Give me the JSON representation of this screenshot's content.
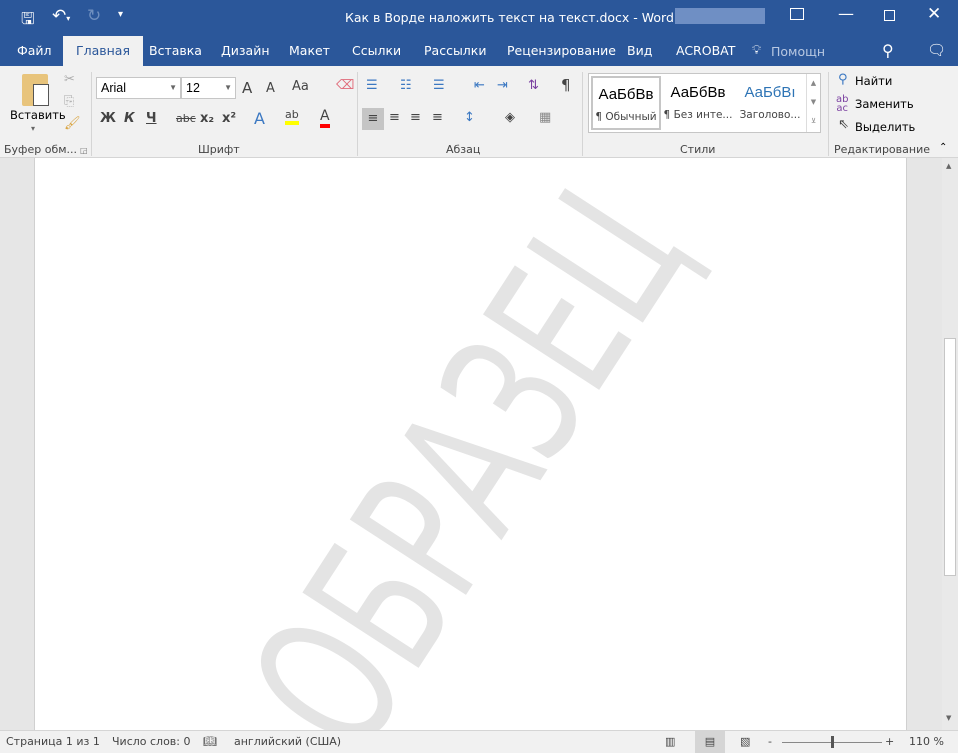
{
  "title_bar": {
    "title": "Как в Ворде наложить текст на текст.docx - Word",
    "icons": [
      "save-icon",
      "undo-icon",
      "redo-icon",
      "customize-qat-icon",
      "ribbon-display-icon",
      "minimize-icon",
      "maximize-icon",
      "close-icon"
    ]
  },
  "tabs": [
    {
      "label": "Файл"
    },
    {
      "label": "Главная"
    },
    {
      "label": "Вставка"
    },
    {
      "label": "Дизайн"
    },
    {
      "label": "Макет"
    },
    {
      "label": "Ссылки"
    },
    {
      "label": "Рассылки"
    },
    {
      "label": "Рецензирование"
    },
    {
      "label": "Вид"
    },
    {
      "label": "ACROBAT"
    }
  ],
  "tell_me": "Помощн",
  "ribbon": {
    "clipboard": {
      "label": "Буфер обм...",
      "paste": "Вставить"
    },
    "font": {
      "label": "Шрифт",
      "font_name": "Arial",
      "font_size": "12",
      "bold": "Ж",
      "italic": "К",
      "underline": "Ч",
      "strike": "abc",
      "sub": "x₂",
      "sup": "x²",
      "case": "Aa",
      "grow": "A",
      "shrink": "A",
      "effects": "A",
      "highlight": "ab",
      "color": "A"
    },
    "paragraph": {
      "label": "Абзац",
      "pilcrow": "¶"
    },
    "styles": {
      "label": "Стили",
      "items": [
        {
          "preview": "АаБбВв",
          "name": "¶ Обычный"
        },
        {
          "preview": "АаБбВв",
          "name": "¶ Без инте..."
        },
        {
          "preview": "АаБбВı",
          "name": "Заголово..."
        }
      ]
    },
    "editing": {
      "label": "Редактирование",
      "find": "Найти",
      "replace": "Заменить",
      "select": "Выделить"
    }
  },
  "document": {
    "watermark": "ОБРАЗЕЦ"
  },
  "status": {
    "page": "Страница 1 из 1",
    "words": "Число слов: 0",
    "language": "английский (США)",
    "zoom": "110 %",
    "zoom_percent": 110
  },
  "colors": {
    "accent": "#2b579a",
    "highlight": "#ffff00",
    "font_color": "#ff0000",
    "heading_style": "#2e74b5"
  }
}
